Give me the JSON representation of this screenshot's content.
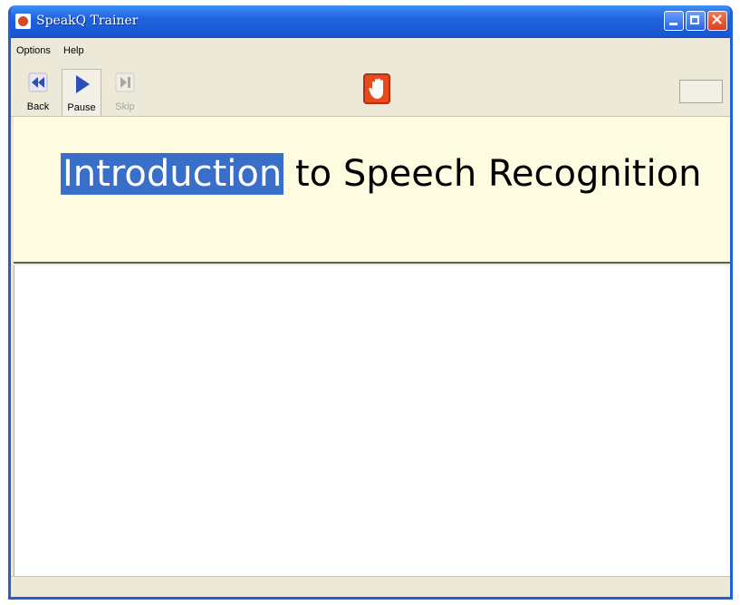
{
  "window": {
    "title": "SpeakQ Trainer"
  },
  "menu": {
    "options": "Options",
    "help": "Help"
  },
  "toolbar": {
    "back": {
      "label": "Back",
      "icon": "rewind-icon"
    },
    "pause": {
      "label": "Pause",
      "icon": "play-icon"
    },
    "skip": {
      "label": "Skip",
      "icon": "skip-icon",
      "enabled": false
    },
    "stop_icon": "hand-stop-icon"
  },
  "lesson": {
    "highlighted_word": "Introduction",
    "rest_of_title": " to Speech Recognition"
  },
  "colors": {
    "titlebar": "#1f63e0",
    "highlight": "#3a6fc9",
    "heading_panel": "#fdfbe0",
    "stop_button": "#e84a1c"
  }
}
